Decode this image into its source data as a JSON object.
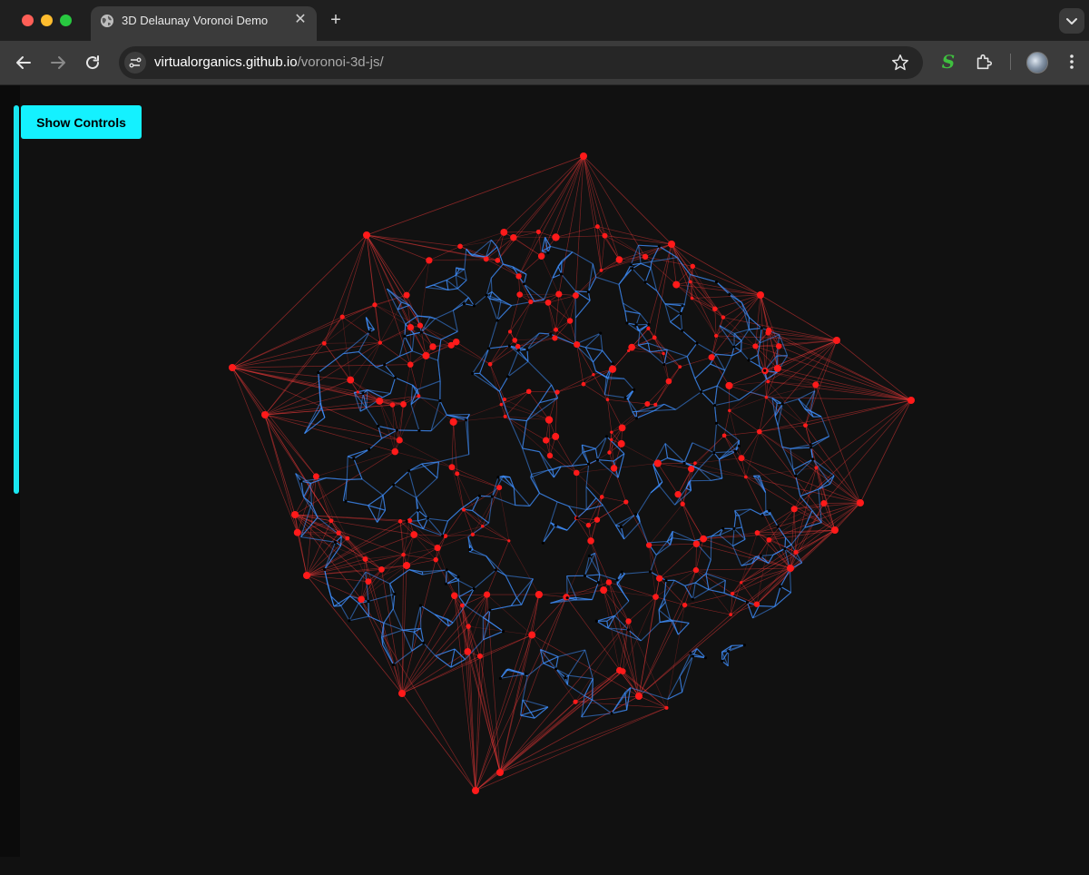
{
  "browser": {
    "tab": {
      "title": "3D Delaunay Voronoi Demo",
      "icon": "globe-icon",
      "close_label": "✕"
    },
    "new_tab_label": "+",
    "url": {
      "domain": "virtualorganics.github.io",
      "path": "/voronoi-3d-js/"
    },
    "extension_label": "S",
    "icons": [
      "back-icon",
      "forward-icon",
      "reload-icon",
      "site-info-icon",
      "star-icon",
      "puzzle-icon",
      "avatar",
      "kebab-menu-icon",
      "tab-search-icon"
    ]
  },
  "page": {
    "show_controls_label": "Show Controls"
  },
  "colors": {
    "background": "#111111",
    "accent_button": "#14f1ff",
    "delaunay_edges": "#ff3b3b",
    "voronoi_edges": "#3f8fff",
    "points": "#ff1a1a"
  }
}
